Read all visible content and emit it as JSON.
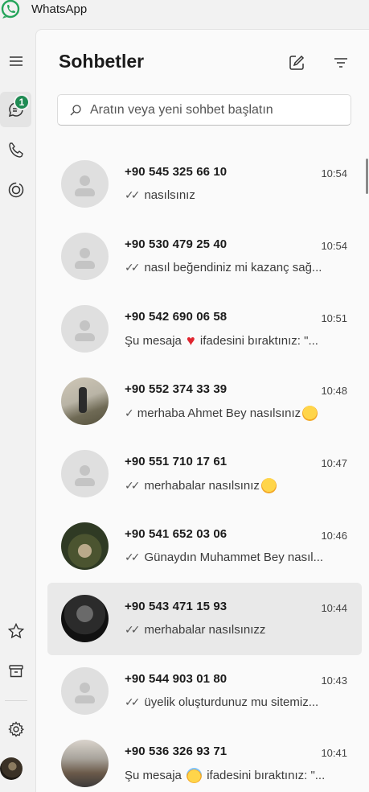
{
  "window": {
    "title": "WhatsApp"
  },
  "rail": {
    "chats_badge": "1"
  },
  "header": {
    "title": "Sohbetler"
  },
  "search": {
    "placeholder": "Aratın veya yeni sohbet başlatın"
  },
  "colors": {
    "badge": "#1f8b53",
    "selected_row": "#e9e9e9",
    "heart": "#e0252f"
  },
  "chats": [
    {
      "name": "+90 545 325 66 10",
      "time": "10:54",
      "tick": "double",
      "parts": [
        "nasılsınız"
      ],
      "avatar": "placeholder"
    },
    {
      "name": "+90 530 479 25 40",
      "time": "10:54",
      "tick": "double",
      "parts": [
        "nasıl beğendiniz mi kazanç sağ..."
      ],
      "avatar": "placeholder"
    },
    {
      "name": "+90 542 690 06 58",
      "time": "10:51",
      "tick": "none",
      "parts": [
        "Şu mesaja ",
        "heart-emoji",
        " ifadesini bıraktınız: \"..."
      ],
      "avatar": "placeholder"
    },
    {
      "name": "+90 552 374 33 39",
      "time": "10:48",
      "tick": "single",
      "parts": [
        "merhaba Ahmet Bey nasılsınız",
        "smile-emoji"
      ],
      "avatar": "photo1"
    },
    {
      "name": "+90 551 710 17 61",
      "time": "10:47",
      "tick": "double",
      "parts": [
        "merhabalar nasılsınız",
        "smile-emoji"
      ],
      "avatar": "placeholder"
    },
    {
      "name": "+90 541 652 03 06",
      "time": "10:46",
      "tick": "double",
      "parts": [
        "Günaydın Muhammet Bey nasıl..."
      ],
      "avatar": "photo2"
    },
    {
      "name": "+90 543 471 15 93",
      "time": "10:44",
      "tick": "double",
      "parts": [
        "merhabalar nasılsınızz"
      ],
      "avatar": "photo3",
      "selected": true
    },
    {
      "name": "+90 544 903 01 80",
      "time": "10:43",
      "tick": "double",
      "parts": [
        "üyelik oluşturdunuz mu sitemiz..."
      ],
      "avatar": "placeholder"
    },
    {
      "name": "+90 536 326 93 71",
      "time": "10:41",
      "tick": "none",
      "parts": [
        "Şu mesaja ",
        "halo-emoji",
        " ifadesini bıraktınız: \"..."
      ],
      "avatar": "photo4"
    }
  ]
}
